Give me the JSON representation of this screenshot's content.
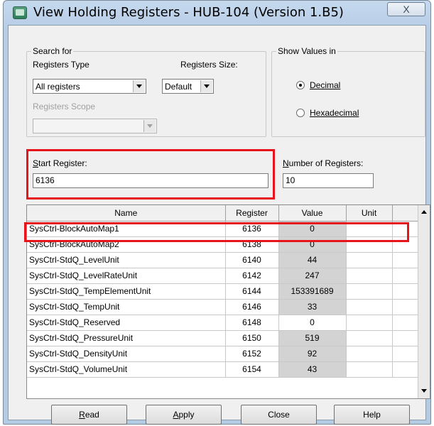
{
  "window": {
    "title": "View Holding Registers - HUB-104 (Version 1.B5)",
    "close_label": "X"
  },
  "search": {
    "legend": "Search for",
    "registers_type_label": "Registers Type",
    "registers_type_value": "All registers",
    "registers_size_label": "Registers Size:",
    "registers_size_value": "Default",
    "registers_scope_label": "Registers Scope",
    "registers_scope_value": ""
  },
  "show_values": {
    "legend": "Show Values in",
    "decimal_label": "Decimal",
    "hexadecimal_label": "Hexadecimal",
    "selected": "Decimal"
  },
  "start_register": {
    "label_key": "S",
    "label_rest": "tart Register:",
    "value": "6136"
  },
  "number_of_registers": {
    "label_key": "N",
    "label_rest": "umber of Registers:",
    "value": "10"
  },
  "table": {
    "columns": [
      "Name",
      "Register",
      "Value",
      "Unit"
    ],
    "rows": [
      {
        "name": "SysCtrl-BlockAutoMap1",
        "register": "6136",
        "value": "0",
        "unit": "",
        "shade": true
      },
      {
        "name": "SysCtrl-BlockAutoMap2",
        "register": "6138",
        "value": "0",
        "unit": "",
        "shade": true
      },
      {
        "name": "SysCtrl-StdQ_LevelUnit",
        "register": "6140",
        "value": "44",
        "unit": "",
        "shade": true
      },
      {
        "name": "SysCtrl-StdQ_LevelRateUnit",
        "register": "6142",
        "value": "247",
        "unit": "",
        "shade": true
      },
      {
        "name": "SysCtrl-StdQ_TempElementUnit",
        "register": "6144",
        "value": "153391689",
        "unit": "",
        "shade": true
      },
      {
        "name": "SysCtrl-StdQ_TempUnit",
        "register": "6146",
        "value": "33",
        "unit": "",
        "shade": true
      },
      {
        "name": "SysCtrl-StdQ_Reserved",
        "register": "6148",
        "value": "0",
        "unit": "",
        "shade": false
      },
      {
        "name": "SysCtrl-StdQ_PressureUnit",
        "register": "6150",
        "value": "519",
        "unit": "",
        "shade": true
      },
      {
        "name": "SysCtrl-StdQ_DensityUnit",
        "register": "6152",
        "value": "92",
        "unit": "",
        "shade": true
      },
      {
        "name": "SysCtrl-StdQ_VolumeUnit",
        "register": "6154",
        "value": "43",
        "unit": "",
        "shade": true
      }
    ]
  },
  "buttons": {
    "read_key": "R",
    "read_rest": "ead",
    "apply_key": "A",
    "apply_rest": "pply",
    "close": "Close",
    "help": "Help"
  },
  "colors": {
    "highlight": "#e8141c",
    "value_shade": "#d3d3d3"
  }
}
